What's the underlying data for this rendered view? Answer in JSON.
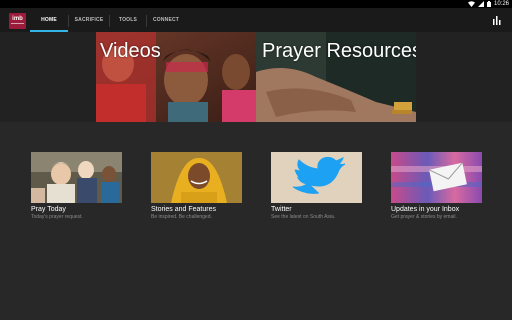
{
  "status_bar": {
    "time": "10:26"
  },
  "app_bar": {
    "logo": "imb",
    "tabs": [
      {
        "label": "HOME",
        "active": true
      },
      {
        "label": "SACRIFICE",
        "active": false
      },
      {
        "label": "TOOLS",
        "active": false
      },
      {
        "label": "CONNECT",
        "active": false
      }
    ]
  },
  "banner": {
    "left_label": "Videos",
    "right_label": "Prayer Resources"
  },
  "cards": [
    {
      "title": "Pray Today",
      "subtitle": "Today's prayer request."
    },
    {
      "title": "Stories and Features",
      "subtitle": "Be inspired. Be challenged."
    },
    {
      "title": "Twitter",
      "subtitle": "See the latest on South Asia."
    },
    {
      "title": "Updates in your Inbox",
      "subtitle": "Get prayer & stories by email."
    }
  ],
  "colors": {
    "accent": "#33b5e5",
    "brand": "#9b1b3a",
    "twitter": "#1da1f2"
  }
}
